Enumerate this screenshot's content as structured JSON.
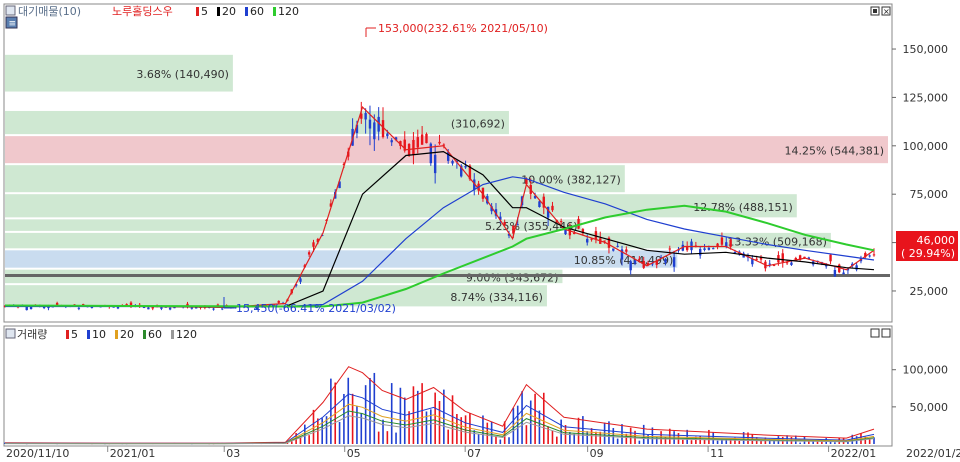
{
  "price_panel": {
    "legend": {
      "title": "대기매물(10)",
      "stock_name": "노루홀딩스우",
      "ma": [
        {
          "label": "5",
          "color": "#e02020"
        },
        {
          "label": "20",
          "color": "#000000"
        },
        {
          "label": "60",
          "color": "#1f3fd0"
        },
        {
          "label": "120",
          "color": "#2ecc2e"
        }
      ]
    },
    "annotations": {
      "high": "153,000(232.61% 2021/05/10)",
      "low": "15,450(-66.41% 2021/03/02)"
    },
    "current_price": {
      "value": "46,000",
      "change": "( 29.94%)"
    }
  },
  "volume_panel": {
    "legend": {
      "title": "거래량",
      "ma": [
        {
          "label": "5",
          "color": "#e02020"
        },
        {
          "label": "10",
          "color": "#1f3fd0"
        },
        {
          "label": "20",
          "color": "#e0a020"
        },
        {
          "label": "60",
          "color": "#2c8a2c"
        },
        {
          "label": "120",
          "color": "#999999"
        }
      ]
    }
  },
  "x_axis": {
    "labels": [
      "2020/11/10",
      "2021/01",
      "03",
      "05",
      "07",
      "09",
      "11",
      "2022/01"
    ],
    "end_label": "2022/01/24"
  },
  "chart_data": [
    {
      "type": "line",
      "title": "",
      "ylim": [
        10000,
        165000
      ],
      "y_ticks": [
        25000,
        50000,
        75000,
        100000,
        125000,
        150000
      ],
      "y_tick_labels": [
        "25,000",
        "50,000",
        "75,000",
        "100,000",
        "125,000",
        "150,000"
      ],
      "x": [
        "2020-11-10",
        "2021-01-01",
        "2021-03-01",
        "2021-04-01",
        "2021-04-20",
        "2021-05-10",
        "2021-06-01",
        "2021-06-20",
        "2021-07-10",
        "2021-07-25",
        "2021-08-01",
        "2021-08-20",
        "2021-09-10",
        "2021-10-01",
        "2021-10-20",
        "2021-11-10",
        "2021-12-01",
        "2021-12-20",
        "2022-01-10",
        "2022-01-24"
      ],
      "series": [
        {
          "color": "#e02020",
          "values": [
            17500,
            17200,
            16500,
            18500,
            55000,
            120000,
            98000,
            100000,
            75000,
            52000,
            80000,
            57000,
            50000,
            38000,
            48000,
            48000,
            38000,
            42000,
            36000,
            46000
          ]
        },
        {
          "color": "#000000",
          "values": [
            17300,
            17200,
            16800,
            17000,
            25000,
            75000,
            95000,
            97000,
            85000,
            68000,
            68000,
            58000,
            52000,
            46000,
            44000,
            45000,
            42000,
            40000,
            37000,
            36000
          ]
        },
        {
          "color": "#1f3fd0",
          "values": [
            17000,
            17000,
            17000,
            17000,
            18000,
            30000,
            52000,
            68000,
            80000,
            84000,
            83000,
            76000,
            70000,
            62000,
            57000,
            53000,
            49000,
            46000,
            43000,
            41000
          ]
        },
        {
          "color": "#2ecc2e",
          "values": [
            17500,
            17300,
            17100,
            17000,
            17000,
            19000,
            26000,
            34000,
            42000,
            48000,
            52000,
            57000,
            63000,
            67000,
            69000,
            66000,
            60000,
            54000,
            49000,
            46000
          ]
        }
      ],
      "volume_profile": [
        {
          "label": "3.68% (140,490)",
          "y_low": 127000,
          "y_high": 147000
        },
        {
          "label": "(310,692)",
          "y_low": 105000,
          "y_high": 118000
        },
        {
          "label": "14.25% (544,381)",
          "y_low": 90000,
          "y_high": 105000
        },
        {
          "label": "10.00% (382,127)",
          "y_low": 75000,
          "y_high": 90000
        },
        {
          "label": "12.78% (488,151)",
          "y_low": 62000,
          "y_high": 75000
        },
        {
          "label": "5.25% (355,446)",
          "y_low": 55000,
          "y_high": 62000
        },
        {
          "label": "13.33% (509,168)",
          "y_low": 46000,
          "y_high": 55000
        },
        {
          "label": "10.85% (414,499)",
          "y_low": 36000,
          "y_high": 46000
        },
        {
          "label": "9.00% (343,672)",
          "y_low": 28000,
          "y_high": 36000
        },
        {
          "label": "8.74% (334,116)",
          "y_low": 16000,
          "y_high": 28000
        }
      ],
      "max_volume_band": {
        "label": "14.25% (544,381)"
      },
      "current_level_band": {
        "label": "10.85% (414,499)"
      },
      "current_price_line": 33000
    },
    {
      "type": "bar",
      "title": "",
      "ylim": [
        0,
        140000
      ],
      "y_ticks": [
        50000,
        100000
      ],
      "y_tick_labels": [
        "50,000",
        "100,000"
      ],
      "x": [
        "2020-11-10",
        "2021-01-01",
        "2021-03-01",
        "2021-04-01",
        "2021-04-20",
        "2021-05-03",
        "2021-05-10",
        "2021-05-20",
        "2021-06-01",
        "2021-06-15",
        "2021-07-01",
        "2021-07-20",
        "2021-08-01",
        "2021-08-20",
        "2021-09-10",
        "2021-10-01",
        "2021-11-01",
        "2021-12-01",
        "2022-01-10",
        "2022-01-24"
      ],
      "values": [
        2000,
        1500,
        1500,
        3000,
        70000,
        130000,
        120000,
        90000,
        75000,
        95000,
        55000,
        30000,
        100000,
        45000,
        35000,
        25000,
        20000,
        15000,
        10000,
        25000
      ]
    }
  ]
}
